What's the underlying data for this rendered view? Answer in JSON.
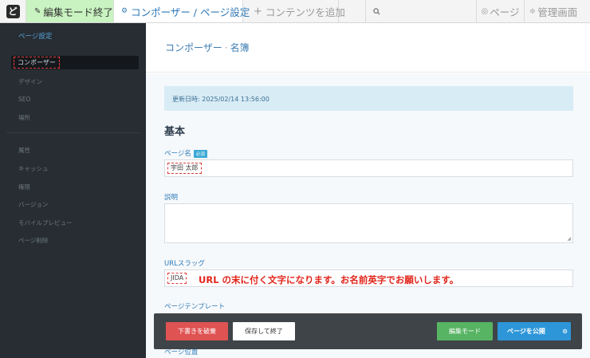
{
  "toolbar": {
    "logo": "ど",
    "exit_edit_mode": "編集モード終了",
    "composer_settings": "コンポーザー / ページ設定",
    "add_content": "コンテンツを追加",
    "page": "ページ",
    "admin": "管理画面",
    "icons": {
      "exit_edit_mode": "pencil-icon",
      "composer_settings": "gear-icon",
      "add_content": "plus-icon",
      "search": "search-icon",
      "page": "page-icon",
      "admin": "sliders-icon"
    }
  },
  "sidebar": {
    "heading": "ページ設定",
    "items": [
      "コンポーザー",
      "デザイン",
      "SEO",
      "場所",
      "属性",
      "キャッシュ",
      "権限",
      "バージョン",
      "モバイルプレビュー",
      "ページ削除"
    ],
    "active_index": 0
  },
  "main": {
    "breadcrumb": {
      "first": "コンポーザー",
      "separator": "·",
      "second": "名簿"
    },
    "updated": "更新日時: 2025/02/14 13:56:00",
    "section_title": "基本",
    "page_name": {
      "label": "ページ名",
      "required_badge": "必須",
      "value": "宇田 太郎"
    },
    "description": {
      "label": "説明",
      "value": ""
    },
    "url_slug": {
      "label": "URLスラッグ",
      "value": "JIDA",
      "note": "URL の末に付く文字になります。お名前英字でお願いします。"
    },
    "page_template": {
      "label": "ページテンプレート"
    },
    "page_location": {
      "label": "ページ位置"
    }
  },
  "actions": {
    "discard": "下書きを破棄",
    "save_exit": "保存して終了",
    "edit_mode": "編集モード",
    "publish": "ページを公開"
  },
  "colors": {
    "accent": "#2f7ab8",
    "sidebar_bg": "#272d33",
    "exit_bg": "#c9f3c0",
    "danger": "#e05353",
    "success": "#57b463",
    "primary": "#2d96d9",
    "note_red": "#e1251b"
  }
}
